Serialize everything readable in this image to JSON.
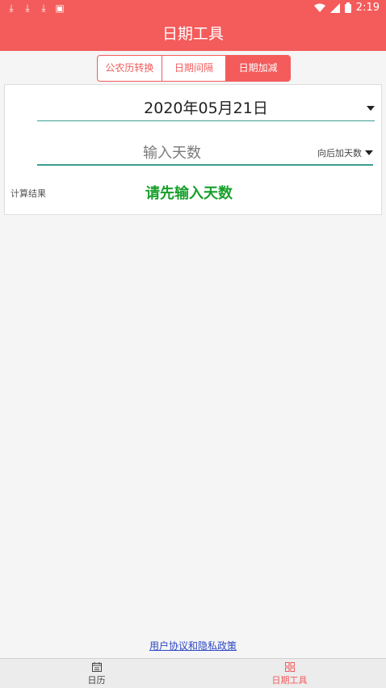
{
  "status_bar": {
    "time": "2:19",
    "left_icons": [
      "download-icon",
      "download-icon",
      "download-icon",
      "app-notification-icon"
    ],
    "right_icons": [
      "wifi-icon",
      "signal-icon",
      "battery-icon"
    ]
  },
  "app": {
    "title": "日期工具"
  },
  "tabs": [
    {
      "label": "公农历转换",
      "active": false
    },
    {
      "label": "日期间隔",
      "active": false
    },
    {
      "label": "日期加减",
      "active": true
    }
  ],
  "form": {
    "date_value": "2020年05月21日",
    "days_placeholder": "输入天数",
    "direction_label": "向后加天数"
  },
  "result": {
    "label": "计算结果",
    "value": "请先输入天数"
  },
  "footer": {
    "privacy_link": "用户协议和隐私政策"
  },
  "bottom_nav": [
    {
      "label": "日历",
      "icon": "calendar-icon",
      "active": false
    },
    {
      "label": "日期工具",
      "icon": "grid-icon",
      "active": true
    }
  ],
  "colors": {
    "accent": "#f45b5b",
    "underline": "#3a9f90",
    "result": "#17a02b",
    "link": "#2f48c5"
  }
}
